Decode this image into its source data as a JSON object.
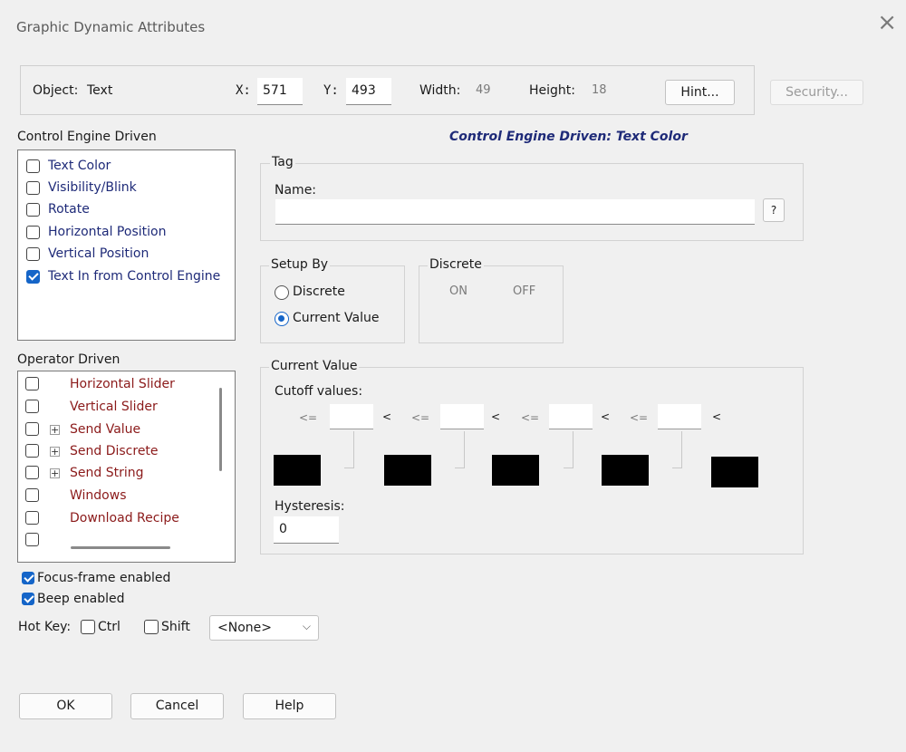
{
  "window": {
    "title": "Graphic Dynamic Attributes",
    "close_glyph": "×"
  },
  "object_bar": {
    "object_label": "Object:",
    "object_value": "Text",
    "x_label": "X:",
    "x_value": "571",
    "y_label": "Y:",
    "y_value": "493",
    "width_label": "Width:",
    "width_value": "49",
    "height_label": "Height:",
    "height_value": "18",
    "hint_button": "Hint...",
    "security_button": "Security..."
  },
  "control_engine": {
    "heading": "Control Engine Driven",
    "items": [
      {
        "label": "Text Color",
        "checked": false
      },
      {
        "label": "Visibility/Blink",
        "checked": false
      },
      {
        "label": "Rotate",
        "checked": false
      },
      {
        "label": "Horizontal Position",
        "checked": false
      },
      {
        "label": "Vertical Position",
        "checked": false
      },
      {
        "label": "Text In from Control Engine",
        "checked": true
      }
    ]
  },
  "panel_heading": "Control Engine Driven: Text Color",
  "operator": {
    "heading": "Operator Driven",
    "items": [
      {
        "label": "Horizontal Slider",
        "expander": false
      },
      {
        "label": "Vertical Slider",
        "expander": false
      },
      {
        "label": "Send Value",
        "expander": true
      },
      {
        "label": "Send Discrete",
        "expander": true
      },
      {
        "label": "Send String",
        "expander": true
      },
      {
        "label": "Windows",
        "expander": false
      },
      {
        "label": "Download Recipe",
        "expander": false
      }
    ],
    "expander_glyph": "+"
  },
  "tag": {
    "group_title": "Tag",
    "name_label": "Name:",
    "name_value": "",
    "help_button": "?"
  },
  "setup_by": {
    "group_title": "Setup By",
    "options": [
      {
        "label": "Discrete",
        "selected": false
      },
      {
        "label": "Current Value",
        "selected": true
      }
    ]
  },
  "discrete": {
    "group_title": "Discrete",
    "on_label": "ON",
    "off_label": "OFF"
  },
  "current_value": {
    "group_title": "Current Value",
    "cutoff_label": "Cutoff values:",
    "lte_symbol": "<=",
    "lt_symbol": "<",
    "color_fill": "#000000",
    "hysteresis_label": "Hysteresis:",
    "hysteresis_value": "0"
  },
  "options": {
    "focus_frame_label": "Focus-frame enabled",
    "focus_frame_checked": true,
    "beep_label": "Beep enabled",
    "beep_checked": true,
    "hotkey_label": "Hot Key:",
    "ctrl_label": "Ctrl",
    "shift_label": "Shift",
    "key_select_value": "<None>",
    "chevron_glyph": "⌵"
  },
  "footer": {
    "ok": "OK",
    "cancel": "Cancel",
    "help": "Help"
  },
  "colors": {
    "accent": "#1565c8",
    "navy_text": "#1e2a78",
    "maroon_text": "#8b1a1a"
  }
}
